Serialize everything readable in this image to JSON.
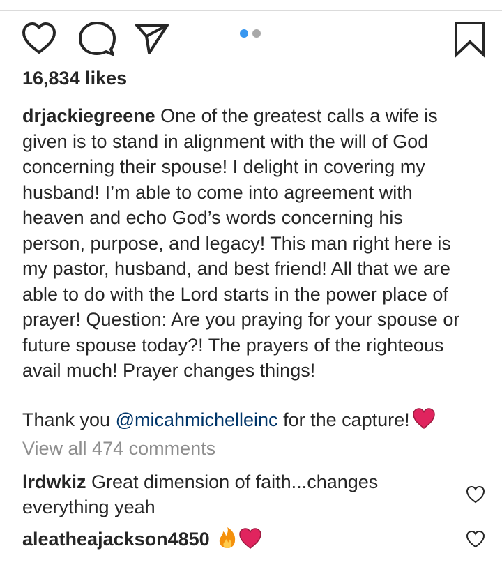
{
  "icons": {
    "like": "heart-outline-icon",
    "comment": "comment-bubble-icon",
    "share": "paper-plane-icon",
    "save": "bookmark-icon",
    "comment_like": "small-heart-outline-icon"
  },
  "carousel": {
    "dot_count": 2,
    "active_index": 0,
    "active_color": "#3897f0",
    "inactive_color": "#a8a8a8"
  },
  "likes": "16,834 likes",
  "caption": {
    "username": "drjackiegreene",
    "text": " One of the greatest calls a wife is\ngiven is to stand in alignment with the will of God\nconcerning their spouse! I delight in covering my\nhusband! I’m able to come into agreement with\nheaven and echo God’s words concerning his\nperson, purpose, and legacy! This man right here is\nmy pastor, husband, and best friend! All that we are\nable to do with the Lord starts in the power place of\nprayer! Question: Are you praying for your spouse or\nfuture spouse today?! The prayers of the righteous\navail much! Prayer changes things!",
    "thanks_prefix": "Thank you ",
    "mention": "@micahmichelleinc",
    "thanks_suffix": " for the capture!",
    "emoji": "❤️"
  },
  "view_comments": "View all 474 comments",
  "comments": [
    {
      "username": "lrdwkiz",
      "text": " Great dimension of faith...changes\neverything yeah"
    },
    {
      "username": "aleatheajackson4850",
      "text": " 🔥❤️"
    }
  ],
  "colors": {
    "text": "#262626",
    "muted": "#8e8e8e",
    "mention": "#003569",
    "heart": "#e0245e"
  }
}
